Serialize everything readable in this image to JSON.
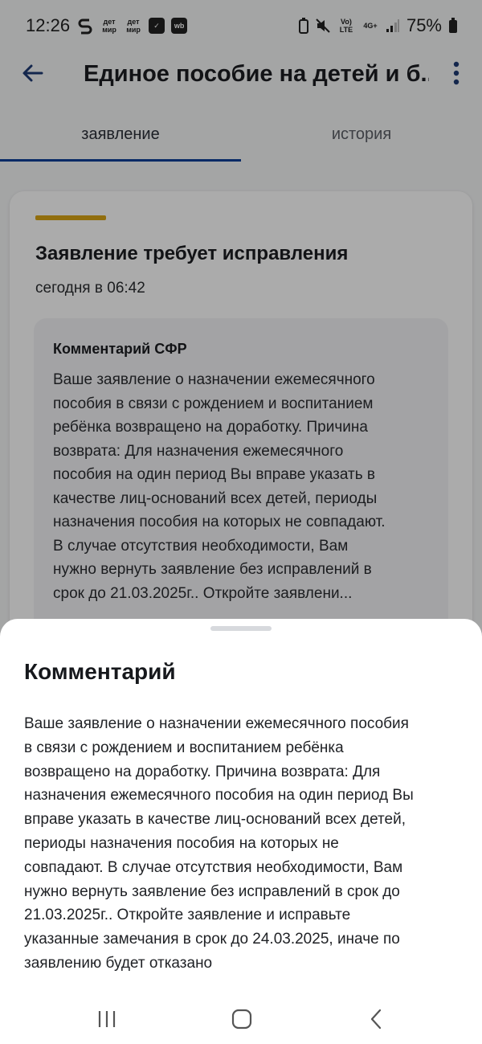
{
  "status_bar": {
    "time": "12:26",
    "left_icons": [
      "s-app-icon",
      "detmir-icon",
      "detmir-icon",
      "check-box-icon",
      "wb-icon"
    ],
    "detmir_label": "дет мир",
    "wb_label": "wb",
    "network_volte": "Vo) LTE",
    "network_4g": "4G+",
    "battery": "75%"
  },
  "header": {
    "title": "Единое пособие на детей и б...",
    "back_icon": "arrow-left-icon",
    "more_icon": "more-vertical-icon"
  },
  "tabs": [
    {
      "label": "заявление",
      "active": true
    },
    {
      "label": "история",
      "active": false
    }
  ],
  "card": {
    "accent_color": "#d9a416",
    "title": "Заявление требует исправления",
    "time": "сегодня в 06:42",
    "comment_heading": "Комментарий СФР",
    "comment_lines": [
      "Ваше заявление о назначении ежемесячного",
      "пособия в связи с рождением и воспитанием",
      "ребёнка возвращено на доработку. Причина",
      "возврата: Для назначения ежемесячного",
      "пособия на один период Вы вправе указать в",
      "качестве лиц-оснований всех детей, периоды",
      "назначения пособия на которых не совпадают.",
      "В случае отсутствия необходимости, Вам",
      "нужно вернуть заявление без исправлений в",
      "срок до 21.03.2025г.. Откройте заявлени..."
    ]
  },
  "sheet": {
    "title": "Комментарий",
    "lines": [
      "Ваше заявление о назначении ежемесячного пособия",
      "в связи с рождением и воспитанием ребёнка",
      "возвращено на доработку. Причина возврата: Для",
      "назначения ежемесячного пособия на один период Вы",
      "вправе указать в качестве лиц-оснований всех детей,",
      "периоды назначения пособия на которых не",
      "совпадают. В случае отсутствия необходимости, Вам",
      "нужно вернуть заявление без исправлений в срок до",
      "21.03.2025г.. Откройте заявление и исправьте",
      "указанные замечания в срок до 24.03.2025, иначе по",
      "заявлению будет отказано"
    ]
  },
  "nav_bar": {
    "recents_icon": "recents-icon",
    "home_icon": "home-icon",
    "back_icon": "back-chevron-icon"
  },
  "colors": {
    "tab_underline": "#0d3f98",
    "scrim": "rgba(0,0,0,0.33)"
  }
}
